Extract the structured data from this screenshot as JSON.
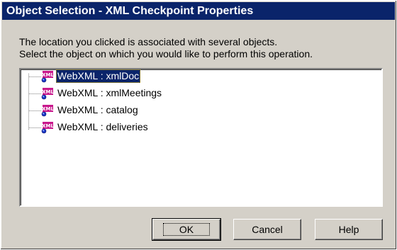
{
  "window": {
    "title": "Object Selection - XML Checkpoint Properties"
  },
  "prompt": {
    "line1": "The location you clicked is associated with several objects.",
    "line2": "Select the object on which you would like to perform this operation."
  },
  "tree": {
    "items": [
      {
        "label": "WebXML : xmlDoc",
        "icon": "xml-object-icon",
        "selected": true
      },
      {
        "label": "WebXML : xmlMeetings",
        "icon": "xml-object-icon",
        "selected": false
      },
      {
        "label": "WebXML : catalog",
        "icon": "xml-object-icon",
        "selected": false
      },
      {
        "label": "WebXML : deliveries",
        "icon": "xml-object-icon",
        "selected": false
      }
    ]
  },
  "buttons": {
    "ok": "OK",
    "cancel": "Cancel",
    "help": "Help"
  },
  "icon_text": "XML",
  "colors": {
    "titlebar": "#0a246a",
    "dialog_face": "#d4d0c8",
    "selection": "#0a246a",
    "icon_magenta": "#c8188c",
    "icon_blue": "#1c3cc8"
  }
}
